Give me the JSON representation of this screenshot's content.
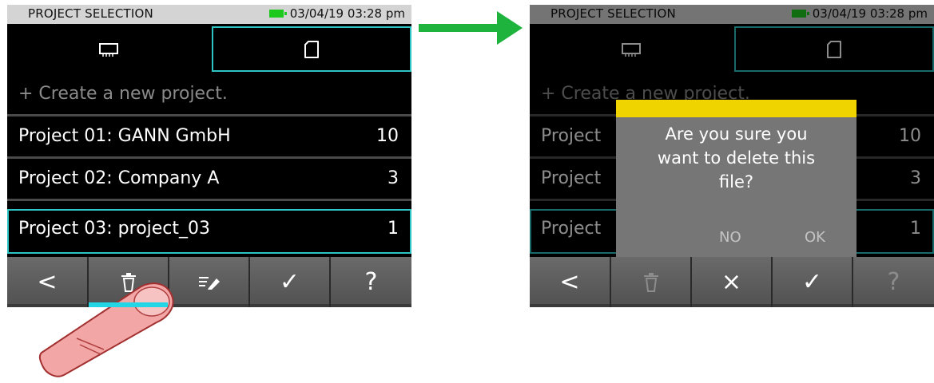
{
  "screen_before": {
    "status": {
      "title": "PROJECT SELECTION",
      "datetime": "03/04/19 03:28 pm"
    },
    "tabs": [
      {
        "icon": "memory-chip-icon"
      },
      {
        "icon": "sd-card-icon"
      }
    ],
    "create_label": "+ Create a new project.",
    "projects": [
      {
        "label": "Project 01: GANN GmbH",
        "count": "10"
      },
      {
        "label": "Project 02: Company A",
        "count": "3"
      },
      {
        "label": "Project 03: project_03",
        "count": "1"
      }
    ],
    "toolbar": {
      "back": "<",
      "delete_icon": "trash-icon",
      "edit_icon": "edit-icon",
      "confirm": "✓",
      "help": "?"
    }
  },
  "screen_after": {
    "status": {
      "title": "PROJECT SELECTION",
      "datetime": "03/04/19 03:28 pm"
    },
    "create_label": "+ Create a new project.",
    "projects": [
      {
        "label": "Project",
        "count": "10"
      },
      {
        "label": "Project",
        "count": "3"
      },
      {
        "label": "Project",
        "count": "1"
      }
    ],
    "dialog": {
      "message_lines": [
        "Are you sure you",
        "want to delete this",
        "file?"
      ],
      "no_label": "NO",
      "ok_label": "OK"
    },
    "toolbar": {
      "back": "<",
      "cancel": "×",
      "confirm": "✓",
      "help": "?"
    }
  },
  "colors": {
    "selection": "#2ec4c4",
    "dialog_header": "#f0d400",
    "arrow": "#1db33d",
    "battery": "#1ec91e"
  }
}
